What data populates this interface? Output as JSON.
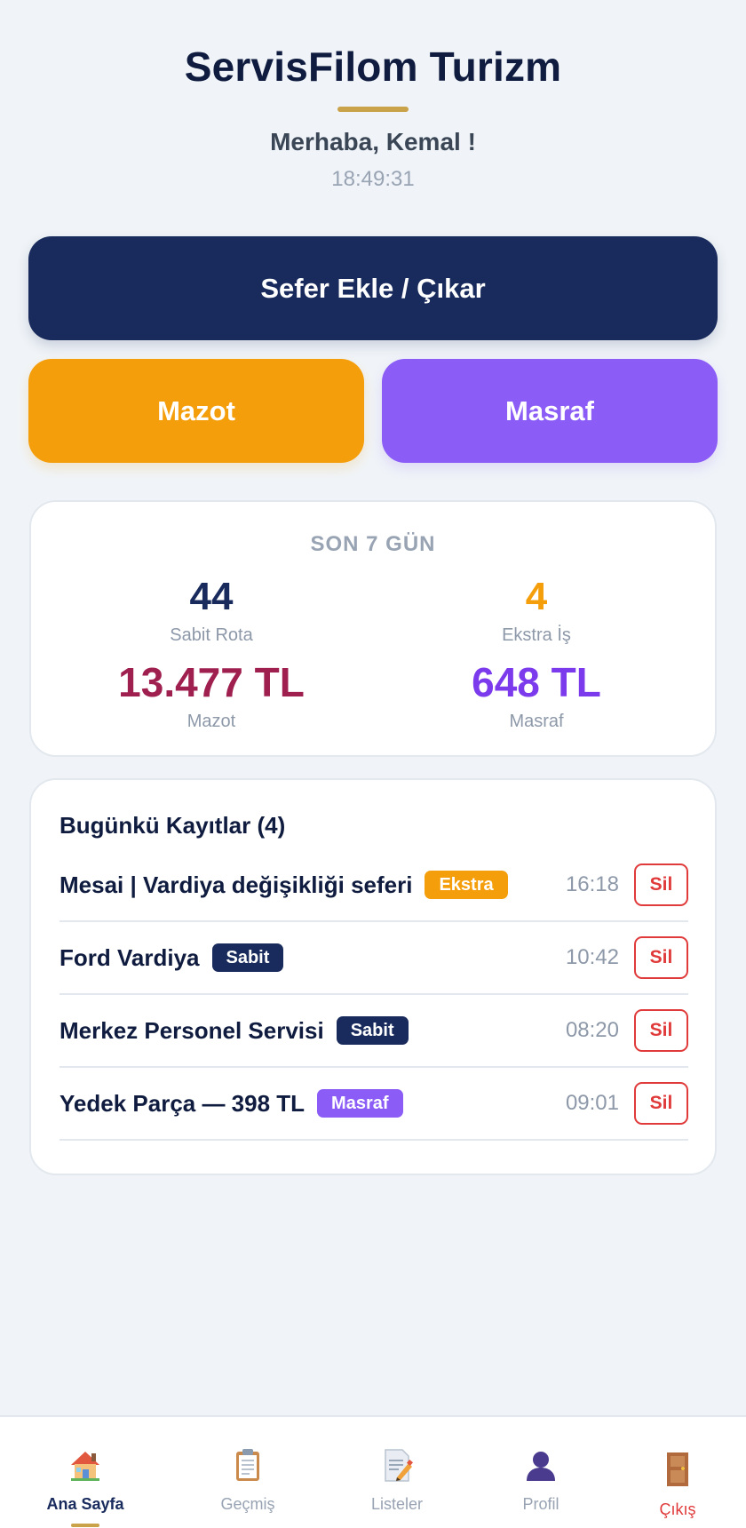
{
  "header": {
    "title": "ServisFilom Turizm",
    "greeting": "Merhaba, Kemal !",
    "clock": "18:49:31"
  },
  "actions": {
    "primary_label": "Sefer Ekle / Çıkar",
    "mazot_label": "Mazot",
    "masraf_label": "Masraf"
  },
  "colors": {
    "navy": "#192b5c",
    "amber": "#f59e0b",
    "purple": "#8b5cf6",
    "crimson": "#9f1f4e",
    "gold": "#c9a24a",
    "danger": "#e03a3a"
  },
  "stats": {
    "title": "SON 7 GÜN",
    "items": [
      {
        "value": "44",
        "label": "Sabit Rota"
      },
      {
        "value": "4",
        "label": "Ekstra İş"
      },
      {
        "value": "13.477 TL",
        "label": "Mazot"
      },
      {
        "value": "648 TL",
        "label": "Masraf"
      }
    ]
  },
  "records": {
    "title": "Bugünkü Kayıtlar (4)",
    "delete_label": "Sil",
    "items": [
      {
        "name": "Mesai | Vardiya değişikliği seferi",
        "badge": "Ekstra",
        "time": "16:18"
      },
      {
        "name": "Ford Vardiya",
        "badge": "Sabit",
        "time": "10:42"
      },
      {
        "name": "Merkez Personel Servisi",
        "badge": "Sabit",
        "time": "08:20"
      },
      {
        "name": "Yedek Parça — 398 TL",
        "badge": "Masraf",
        "time": "09:01"
      }
    ]
  },
  "nav": {
    "items": [
      {
        "label": "Ana Sayfa",
        "icon": "house-icon",
        "active": true
      },
      {
        "label": "Geçmiş",
        "icon": "clipboard-icon",
        "active": false
      },
      {
        "label": "Listeler",
        "icon": "document-pencil-icon",
        "active": false
      },
      {
        "label": "Profil",
        "icon": "person-icon",
        "active": false
      },
      {
        "label": "Çıkış",
        "icon": "door-icon",
        "active": false
      }
    ]
  }
}
